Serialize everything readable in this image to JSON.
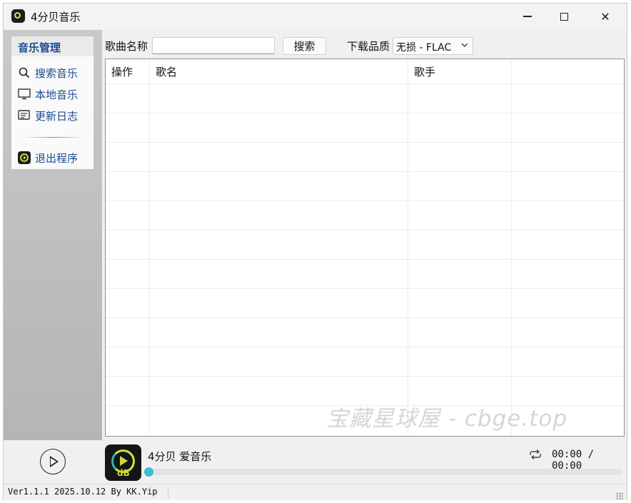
{
  "window": {
    "title": "4分贝音乐",
    "controls": {
      "minimize": "minimize-icon",
      "maximize": "maximize-icon",
      "close": "close-icon"
    }
  },
  "sidebar": {
    "header": "音乐管理",
    "items": [
      {
        "label": "搜索音乐",
        "icon": "search-icon"
      },
      {
        "label": "本地音乐",
        "icon": "monitor-icon"
      },
      {
        "label": "更新日志",
        "icon": "log-icon"
      },
      {
        "label": "退出程序",
        "icon": "app-icon"
      }
    ]
  },
  "toolbar": {
    "song_label": "歌曲名称",
    "song_value": "",
    "search_button": "搜索",
    "quality_label": "下载品质",
    "quality_value": "无损 - FLAC"
  },
  "table": {
    "columns": [
      "操作",
      "歌名",
      "歌手",
      ""
    ],
    "rows": []
  },
  "watermark": "宝藏星球屋 - cbge.top",
  "player": {
    "track": "4分贝 爱音乐",
    "time": "00:00 / 00:00",
    "cover_text": "dB",
    "progress": 0
  },
  "status": {
    "version": "Ver1.1.1 2025.10.12 By KK.Yip"
  }
}
